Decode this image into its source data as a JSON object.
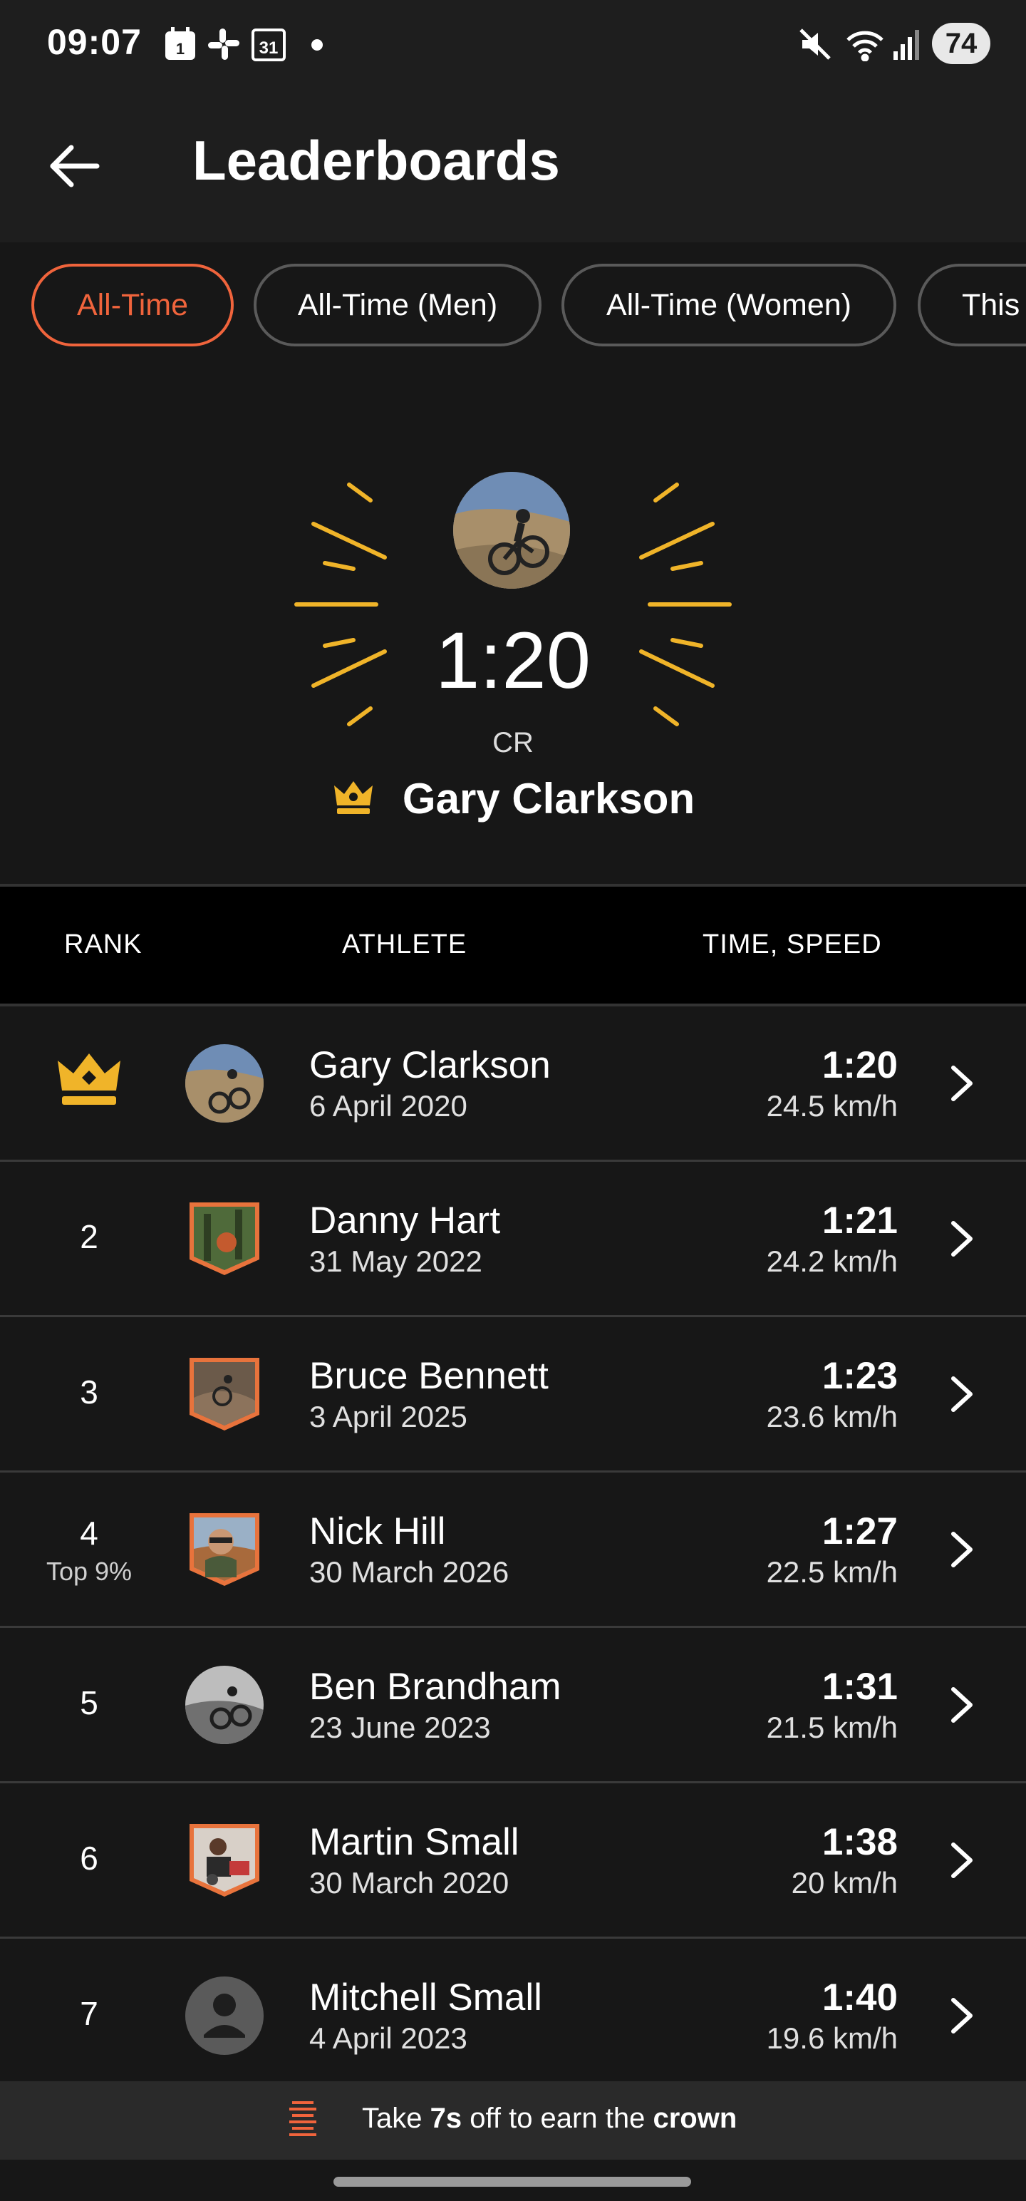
{
  "status_bar": {
    "time": "09:07",
    "calendar_day": "31",
    "notif_badge": "1",
    "battery": "74",
    "icons": [
      "calendar-icon",
      "slack-icon",
      "calendar-31-icon",
      "dot-icon",
      "mute-icon",
      "wifi-icon",
      "signal-icon",
      "battery-icon"
    ]
  },
  "app_bar": {
    "title": "Leaderboards"
  },
  "filters": [
    {
      "label": "All-Time",
      "active": true
    },
    {
      "label": "All-Time (Men)",
      "active": false
    },
    {
      "label": "All-Time (Women)",
      "active": false
    },
    {
      "label": "This",
      "active": false
    }
  ],
  "hero": {
    "time": "1:20",
    "badge": "CR",
    "name": "Gary Clarkson"
  },
  "table": {
    "headers": {
      "rank": "RANK",
      "athlete": "ATHLETE",
      "time_speed": "TIME, SPEED"
    },
    "rows": [
      {
        "rank": "",
        "crown": true,
        "rank_sub": "",
        "name": "Gary Clarkson",
        "date": "6 April 2020",
        "time": "1:20",
        "speed": "24.5 km/h"
      },
      {
        "rank": "2",
        "rank_sub": "",
        "name": "Danny Hart",
        "date": "31 May 2022",
        "time": "1:21",
        "speed": "24.2 km/h"
      },
      {
        "rank": "3",
        "rank_sub": "",
        "name": "Bruce Bennett",
        "date": "3 April 2025",
        "time": "1:23",
        "speed": "23.6 km/h"
      },
      {
        "rank": "4",
        "rank_sub": "Top 9%",
        "name": "Nick Hill",
        "date": "30 March 2026",
        "time": "1:27",
        "speed": "22.5 km/h"
      },
      {
        "rank": "5",
        "rank_sub": "",
        "name": "Ben Brandham",
        "date": "23 June 2023",
        "time": "1:31",
        "speed": "21.5 km/h"
      },
      {
        "rank": "6",
        "rank_sub": "",
        "name": "Martin Small",
        "date": "30 March 2020",
        "time": "1:38",
        "speed": "20 km/h"
      },
      {
        "rank": "7",
        "rank_sub": "",
        "name": "Mitchell Small",
        "date": "4 April 2023",
        "time": "1:40",
        "speed": "19.6 km/h"
      }
    ]
  },
  "banner": {
    "prefix": "Take ",
    "seconds": "7s",
    "middle": " off to earn the ",
    "crown": "crown"
  },
  "colors": {
    "accent": "#f0643c",
    "gold": "#f0b429",
    "background": "#171717"
  }
}
